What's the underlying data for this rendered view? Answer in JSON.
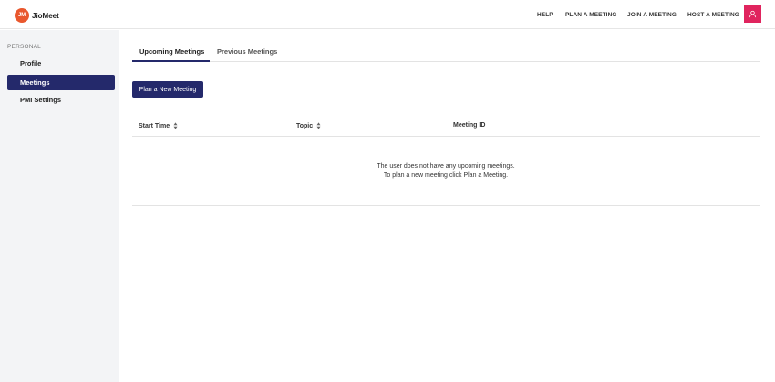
{
  "app": {
    "logo_mark": "JM",
    "name": "JioMeet"
  },
  "header": {
    "nav": {
      "help": "HELP",
      "plan": "PLAN A MEETING",
      "join": "JOIN A MEETING",
      "host": "HOST A MEETING"
    },
    "avatar_icon": "user-icon",
    "avatar_color": "#e0245e"
  },
  "sidebar": {
    "section": "PERSONAL",
    "items": [
      {
        "label": "Profile",
        "active": false
      },
      {
        "label": "Meetings",
        "active": true
      },
      {
        "label": "PMI Settings",
        "active": false
      }
    ]
  },
  "tabs": [
    {
      "label": "Upcoming Meetings",
      "active": true
    },
    {
      "label": "Previous Meetings",
      "active": false
    }
  ],
  "actions": {
    "plan_button": "Plan a New Meeting"
  },
  "table": {
    "columns": [
      {
        "label": "Start Time",
        "sortable": true
      },
      {
        "label": "Topic",
        "sortable": true
      },
      {
        "label": "Meeting ID",
        "sortable": false
      }
    ],
    "rows": [],
    "empty_line1": "The user does not have any upcoming meetings.",
    "empty_line2": "To plan a new meeting click Plan a Meeting."
  },
  "colors": {
    "brand_primary": "#24296b",
    "logo_orange": "#e9572d",
    "accent_pink": "#e0245e",
    "sidebar_bg": "#f3f4f6"
  }
}
